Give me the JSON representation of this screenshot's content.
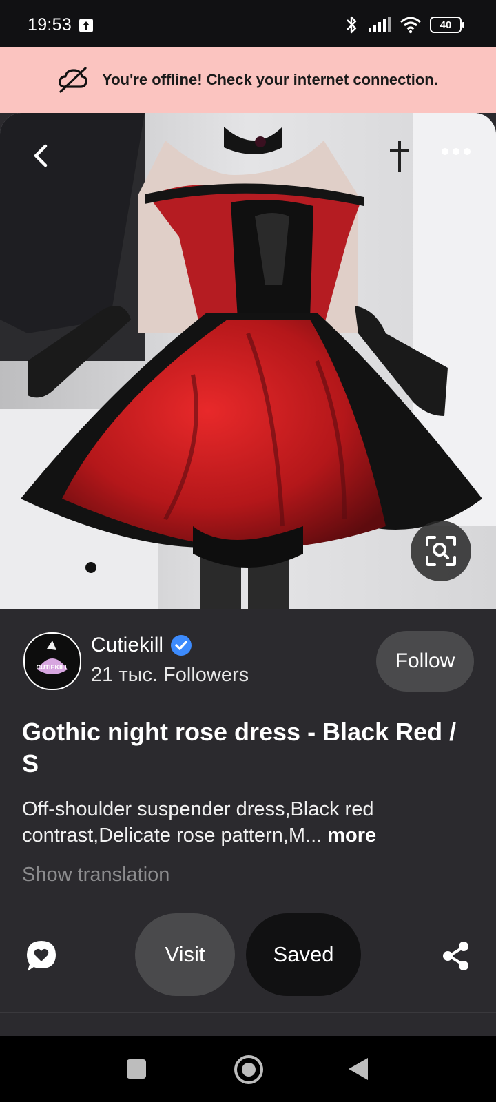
{
  "status_bar": {
    "time": "19:53",
    "battery": "40",
    "icons": [
      "upload-icon",
      "bluetooth-icon",
      "signal-icon",
      "wifi-icon",
      "battery-icon"
    ]
  },
  "offline_banner": {
    "icon": "cloud-off-icon",
    "text": "You're offline! Check your internet connection."
  },
  "hero": {
    "icons": [
      "back-arrow-icon",
      "more-options-icon",
      "visual-search-icon"
    ]
  },
  "creator": {
    "name": "Cutiekill",
    "verified": true,
    "followers": "21 тыс. Followers",
    "follow_label": "Follow",
    "avatar_text": "CUTIEKILL"
  },
  "pin": {
    "title": "Gothic night rose dress - Black Red / S",
    "description": "Off-shoulder suspender dress,Black red contrast,Delicate rose pattern,M...",
    "more_label": "more",
    "translation_label": "Show translation"
  },
  "actions": {
    "visit_label": "Visit",
    "saved_label": "Saved",
    "icons": [
      "comment-heart-icon",
      "share-icon"
    ]
  },
  "colors": {
    "banner_bg": "#fbc4c0",
    "page_bg": "#2b2a2e",
    "button_gray": "#4a4a4c",
    "button_dark": "#111112",
    "verified_blue": "#3d8bfd"
  }
}
